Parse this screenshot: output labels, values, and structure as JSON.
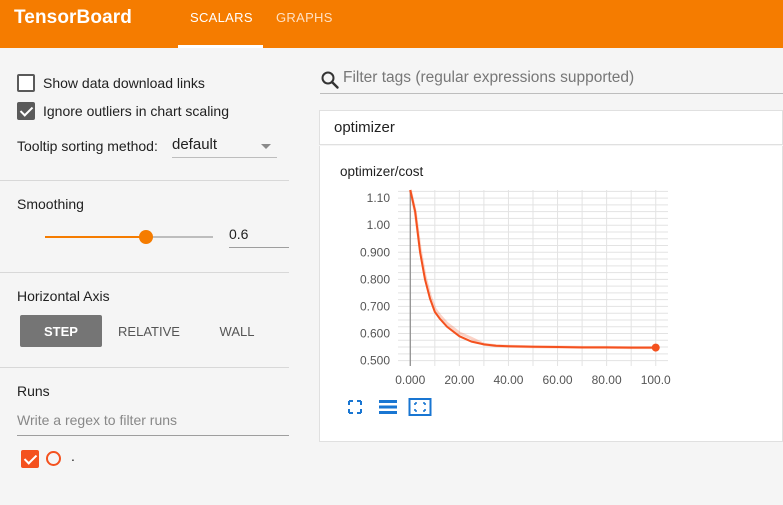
{
  "header": {
    "brand": "TensorBoard",
    "tabs": [
      {
        "label": "SCALARS",
        "active": true
      },
      {
        "label": "GRAPHS",
        "active": false
      }
    ],
    "color": "#f57c00"
  },
  "sidebar": {
    "show_download_links": {
      "label": "Show data download links",
      "checked": false
    },
    "ignore_outliers": {
      "label": "Ignore outliers in chart scaling",
      "checked": true
    },
    "tooltip_sorting": {
      "label": "Tooltip sorting method:",
      "value": "default"
    },
    "smoothing": {
      "title": "Smoothing",
      "value": "0.6",
      "fraction": 0.6
    },
    "horizontal_axis": {
      "title": "Horizontal Axis",
      "options": [
        {
          "label": "STEP",
          "active": true
        },
        {
          "label": "RELATIVE",
          "active": false
        },
        {
          "label": "WALL",
          "active": false
        }
      ]
    },
    "runs": {
      "title": "Runs",
      "filter_placeholder": "Write a regex to filter runs",
      "items": [
        {
          "name": ".",
          "checked": true,
          "color": "#f4511e"
        }
      ]
    }
  },
  "main": {
    "search_placeholder": "Filter tags (regular expressions supported)",
    "group_title": "optimizer",
    "chart_title": "optimizer/cost",
    "toolbar": [
      "expand-icon",
      "data-table-icon",
      "fit-domain-icon"
    ]
  },
  "chart_data": {
    "type": "line",
    "title": "optimizer/cost",
    "xlabel": "",
    "ylabel": "",
    "xlim": [
      -5,
      105
    ],
    "ylim": [
      0.48,
      1.13
    ],
    "x_ticks": [
      "0.000",
      "20.00",
      "40.00",
      "60.00",
      "80.00",
      "100.0"
    ],
    "y_ticks": [
      "0.500",
      "0.600",
      "0.700",
      "0.800",
      "0.900",
      "1.00",
      "1.10"
    ],
    "series": [
      {
        "color": "#f4511e",
        "x": [
          0,
          2,
          4,
          6,
          8,
          10,
          12,
          15,
          20,
          25,
          30,
          35,
          40,
          50,
          60,
          70,
          80,
          90,
          100
        ],
        "y": [
          1.3,
          1.05,
          0.9,
          0.8,
          0.73,
          0.68,
          0.655,
          0.625,
          0.59,
          0.57,
          0.56,
          0.555,
          0.553,
          0.551,
          0.55,
          0.549,
          0.549,
          0.548,
          0.548
        ]
      }
    ],
    "grid": true
  }
}
